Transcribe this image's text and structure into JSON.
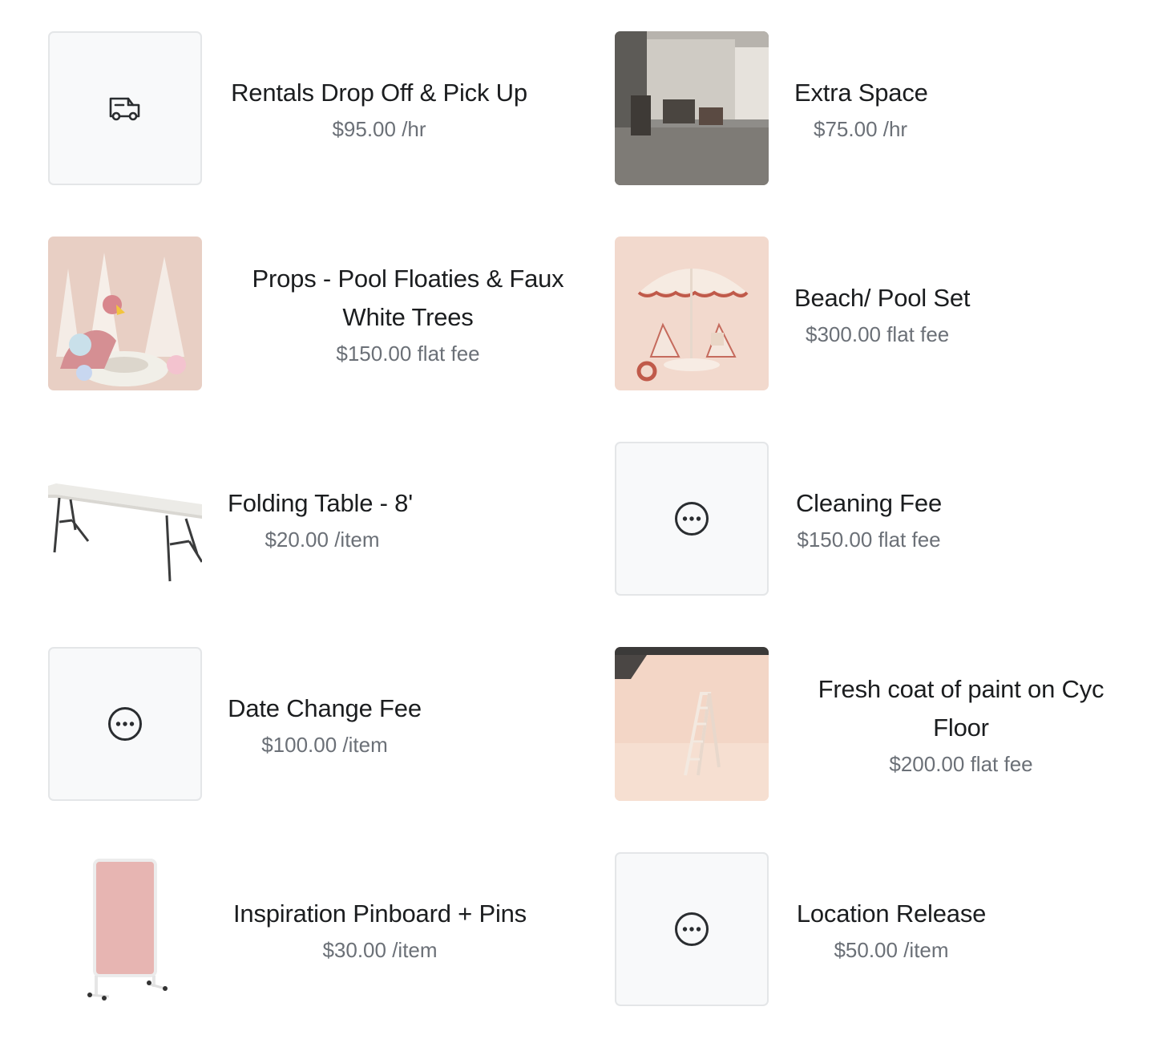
{
  "items": [
    {
      "title": "Rentals Drop Off & Pick Up",
      "price": "$95.00 /hr",
      "icon": "van-icon"
    },
    {
      "title": "Extra Space",
      "price": "$75.00 /hr",
      "image": "studio-space-photo"
    },
    {
      "title": "Props - Pool Floaties & Faux White Trees",
      "price": "$150.00 flat fee",
      "image": "pool-floaties-photo"
    },
    {
      "title": "Beach/ Pool Set",
      "price": "$300.00 flat fee",
      "image": "beach-umbrella-set-photo"
    },
    {
      "title": "Folding Table - 8'",
      "price": "$20.00 /item",
      "image": "folding-table-photo"
    },
    {
      "title": "Cleaning Fee",
      "price": "$150.00 flat fee",
      "icon": "more-icon"
    },
    {
      "title": "Date Change Fee",
      "price": "$100.00 /item",
      "icon": "more-icon"
    },
    {
      "title": "Fresh coat of paint on Cyc Floor",
      "price": "$200.00 flat fee",
      "image": "cyc-ladder-photo"
    },
    {
      "title": "Inspiration Pinboard + Pins",
      "price": "$30.00 /item",
      "image": "pinboard-photo"
    },
    {
      "title": "Location Release",
      "price": "$50.00 /item",
      "icon": "more-icon"
    }
  ]
}
